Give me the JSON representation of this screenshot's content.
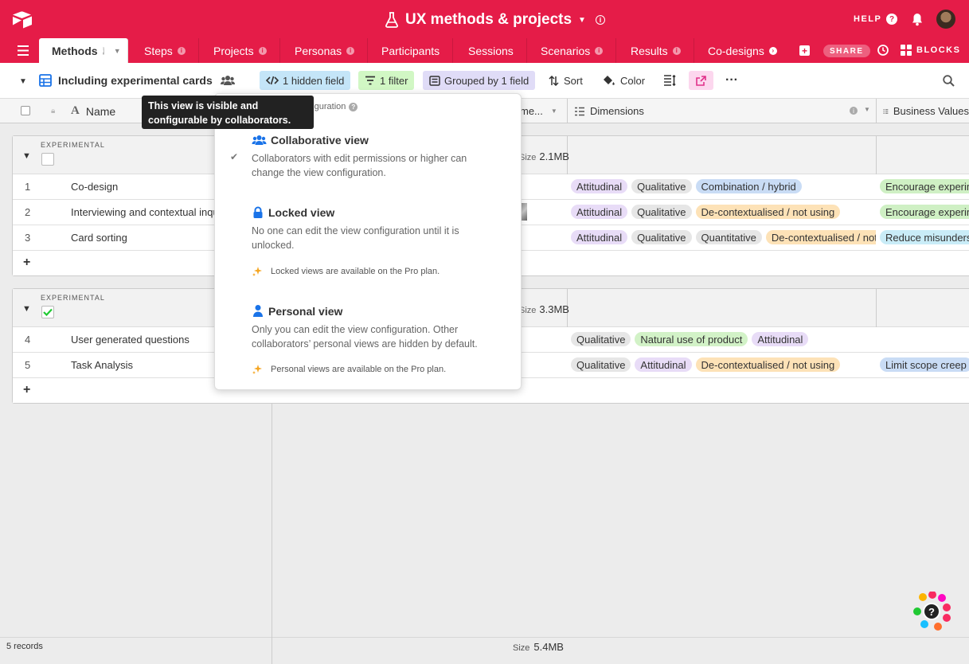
{
  "header": {
    "base_title": "UX methods & projects",
    "help_label": "HELP",
    "colors": {
      "brand": "#e51c48"
    }
  },
  "tabs": [
    {
      "label": "Methods",
      "active": true
    },
    {
      "label": "Steps"
    },
    {
      "label": "Projects"
    },
    {
      "label": "Personas"
    },
    {
      "label": "Participants"
    },
    {
      "label": "Sessions"
    },
    {
      "label": "Scenarios"
    },
    {
      "label": "Results"
    },
    {
      "label": "Co-designs"
    }
  ],
  "share_label": "SHARE",
  "blocks_label": "BLOCKS",
  "viewbar": {
    "view_name": "Including experimental cards",
    "hidden_fields": "1 hidden field",
    "filter": "1 filter",
    "grouped": "Grouped by 1 field",
    "sort": "Sort",
    "color": "Color"
  },
  "columns": {
    "name": "Name",
    "attachments_partial": "me...",
    "dimensions": "Dimensions",
    "business_values": "Business Values"
  },
  "groups": [
    {
      "label": "EXPERIMENTAL",
      "checked": false,
      "size_label": "Size",
      "size": "2.1MB",
      "rows": [
        {
          "num": "1",
          "name": "Co-design",
          "dimensions": [
            "Attitudinal",
            "Qualitative",
            "Combination / hybrid"
          ],
          "business": "Encourage experimentation"
        },
        {
          "num": "2",
          "name": "Interviewing and contextual inquiry",
          "dimensions": [
            "Attitudinal",
            "Qualitative",
            "De-contextualised / not using"
          ],
          "business": "Encourage experimentation"
        },
        {
          "num": "3",
          "name": "Card sorting",
          "dimensions": [
            "Attitudinal",
            "Qualitative",
            "Quantitative",
            "De-contextualised / not using"
          ],
          "business": "Reduce misunderstanding"
        }
      ]
    },
    {
      "label": "EXPERIMENTAL",
      "checked": true,
      "size_label": "Size",
      "size": "3.3MB",
      "rows": [
        {
          "num": "4",
          "name": "User generated questions",
          "dimensions": [
            "Qualitative",
            "Natural use of product",
            "Attitudinal"
          ],
          "business": ""
        },
        {
          "num": "5",
          "name": "Task Analysis",
          "dimensions": [
            "Qualitative",
            "Attitudinal",
            "De-contextualised / not using"
          ],
          "business": "Limit scope creep"
        }
      ]
    }
  ],
  "footer": {
    "records": "5 records",
    "size_label": "Size",
    "size": "5.4MB"
  },
  "dropdown": {
    "header": "nfiguration",
    "options": [
      {
        "title": "Collaborative view",
        "desc": "Collaborators with edit permissions or higher can change the view configuration.",
        "selected": true
      },
      {
        "title": "Locked view",
        "desc": "No one can edit the view configuration until it is unlocked.",
        "promo": "Locked views are available on the Pro plan."
      },
      {
        "title": "Personal view",
        "desc": "Only you can edit the view configuration. Other collaborators’ personal views are hidden by default.",
        "promo": "Personal views are available on the Pro plan."
      }
    ]
  },
  "tooltip": "This view is visible and configurable by collaborators."
}
